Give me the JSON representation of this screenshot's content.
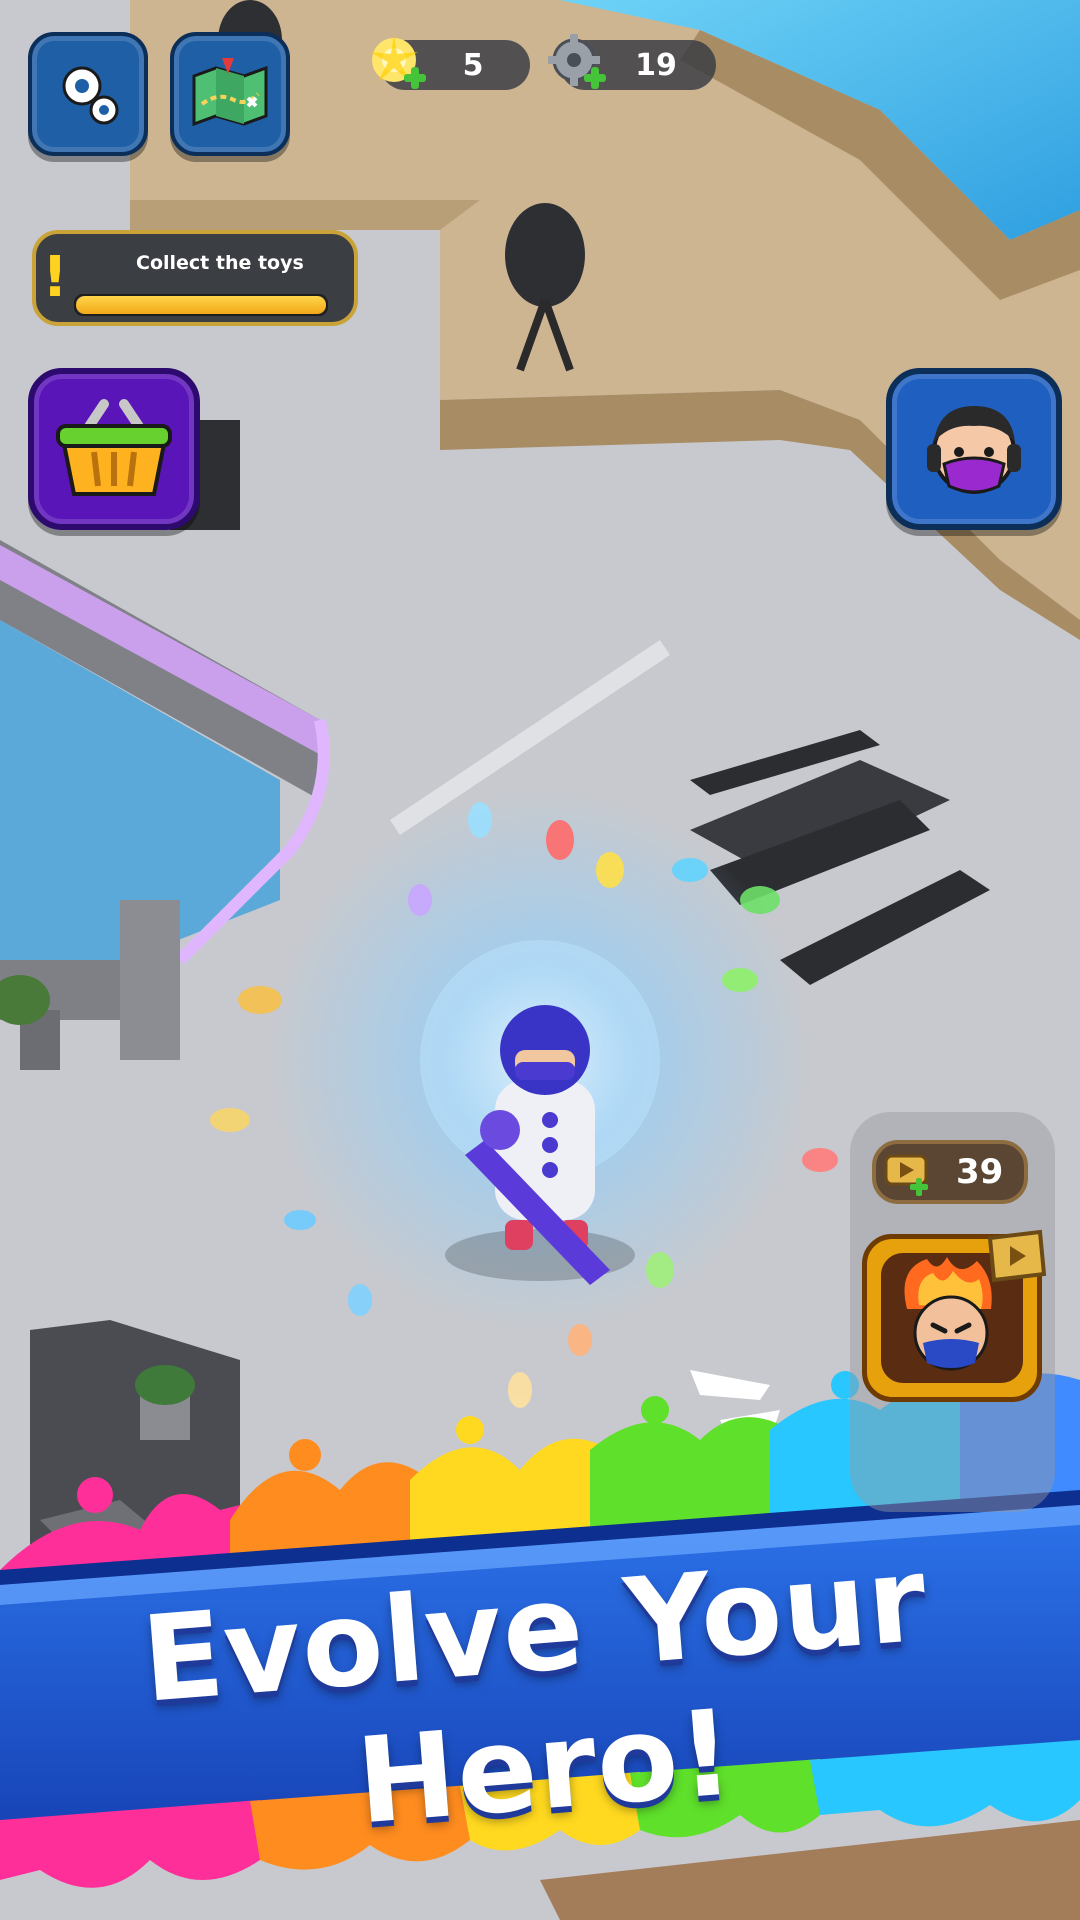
{
  "hud": {
    "settings_icon": "gear-cluster-icon",
    "map_icon": "treasure-map-icon",
    "energy": {
      "icon": "energy-spark-icon",
      "value": "5"
    },
    "gears": {
      "icon": "gear-plus-icon",
      "value": "19"
    }
  },
  "quest": {
    "title": "Collect the toys",
    "progress": 1.0,
    "icon": "exclamation-icon"
  },
  "shop": {
    "icon": "shopping-basket-icon"
  },
  "hero_profile": {
    "icon": "masked-hero-avatar-icon"
  },
  "evolve_panel": {
    "currency_icon": "video-ticket-icon",
    "currency_value": "39",
    "hero_card_icon": "flame-hero-card-icon",
    "watch_ad_icon": "play-video-icon"
  },
  "banner": {
    "text": "Evolve Your Hero!"
  },
  "colors": {
    "accent_blue": "#1d5fd6",
    "purple_frame": "#6a12c8",
    "gold_frame": "#c9a238"
  }
}
